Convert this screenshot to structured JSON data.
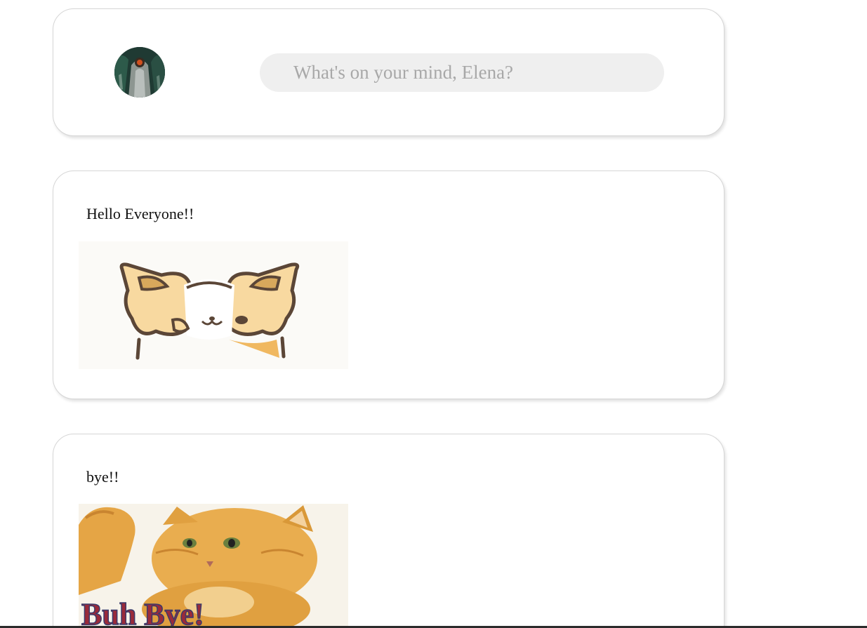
{
  "composer": {
    "placeholder": "What's on your mind, Elena?",
    "avatar_icon": "user-avatar-icon"
  },
  "posts": [
    {
      "text": "Hello Everyone!!",
      "media_icon": "corgi-gif-image"
    },
    {
      "text": "bye!!",
      "media_icon": "kitten-gif-image",
      "media_caption": "Buh Bye!"
    }
  ],
  "colors": {
    "card_border": "#d6d6d6",
    "input_background": "#efefef",
    "placeholder": "#a8a8a8"
  }
}
